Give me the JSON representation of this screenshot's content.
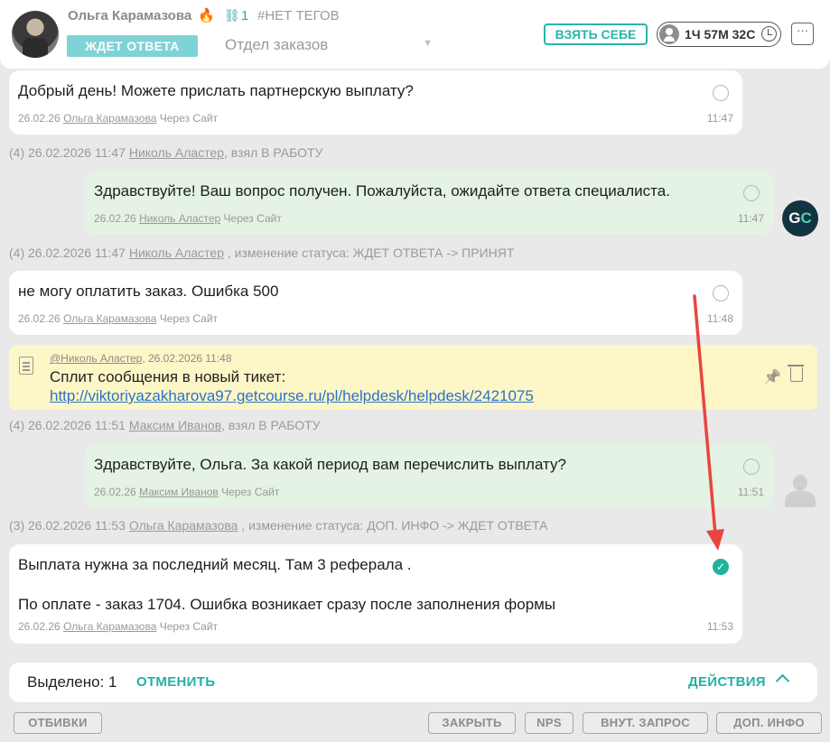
{
  "header": {
    "client_name": "Ольга Карамазова",
    "fire_icon": "🔥",
    "link_icon": "⛓",
    "link_count": "1",
    "tags": "#НЕТ ТЕГОВ",
    "status": "ЖДЕТ ОТВЕТА",
    "department": "Отдел заказов",
    "take_label": "ВЗЯТЬ СЕБЕ",
    "timer": "1Ч 57М 32С",
    "more": "···"
  },
  "messages": [
    {
      "text": "Добрый день! Можете прислать партнерскую выплату?",
      "date": "26.02.26",
      "author": "Ольга Карамазова",
      "via": "Через Сайт",
      "time": "11:47"
    },
    {
      "text": "Здравствуйте! Ваш вопрос получен. Пожалуйста, ожидайте ответа специалиста.",
      "date": "26.02.26",
      "author": "Николь Аластер",
      "via": "Через Сайт",
      "time": "11:47"
    },
    {
      "text": "не могу оплатить заказ. Ошибка 500",
      "date": "26.02.26",
      "author": "Ольга Карамазова",
      "via": "Через Сайт",
      "time": "11:48"
    },
    {
      "text": "Здравствуйте, Ольга. За какой период вам перечислить выплату?",
      "date": "26.02.26",
      "author": "Максим Иванов",
      "via": "Через Сайт",
      "time": "11:51"
    },
    {
      "text1": "Выплата нужна за последний месяц. Там 3 реферала .",
      "text2": "По оплате - заказ 1704. Ошибка возникает сразу после заполнения формы",
      "date": "26.02.26",
      "author": "Ольга Карамазова",
      "via": "Через Сайт",
      "time": "11:53",
      "check": "✓"
    }
  ],
  "system": [
    {
      "prefix": "(4) 26.02.2026 11:47",
      "user": "Николь Аластер",
      "suffix": ", взял В РАБОТУ"
    },
    {
      "prefix": "(4) 26.02.2026 11:47",
      "user": "Николь Аластер",
      "suffix": " , изменение статуса: ЖДЕТ ОТВЕТА -> ПРИНЯТ"
    },
    {
      "prefix": "(4) 26.02.2026 11:51",
      "user": "Максим Иванов",
      "suffix": ", взял В РАБОТУ"
    },
    {
      "prefix": "(3) 26.02.2026 11:53",
      "user": "Ольга Карамазова",
      "suffix": " , изменение статуса: ДОП. ИНФО -> ЖДЕТ ОТВЕТА"
    }
  ],
  "note": {
    "author": "@Николь Аластер",
    "date": ", 26.02.2026 11:48",
    "title": "Сплит сообщения в новый тикет:",
    "link": "http://viktoriyazakharova97.getcourse.ru/pl/helpdesk/helpdesk/2421075",
    "pin_icon": "📌"
  },
  "agent_avatar": {
    "g": "G",
    "c": "C"
  },
  "selection": {
    "count": "Выделено: 1",
    "cancel": "ОТМЕНИТЬ",
    "actions": "ДЕЙСТВИЯ"
  },
  "buttons": {
    "templates": "ОТБИВКИ",
    "close": "ЗАКРЫТЬ",
    "nps": "NPS",
    "internal": "ВНУТ. ЗАПРОС",
    "more_info": "ДОП. ИНФО"
  },
  "colors": {
    "accent": "#22b1a6",
    "annotation_arrow": "#e8463f",
    "agent_bubble": "#e4f3e3",
    "note_bg": "#fdf6c7"
  }
}
